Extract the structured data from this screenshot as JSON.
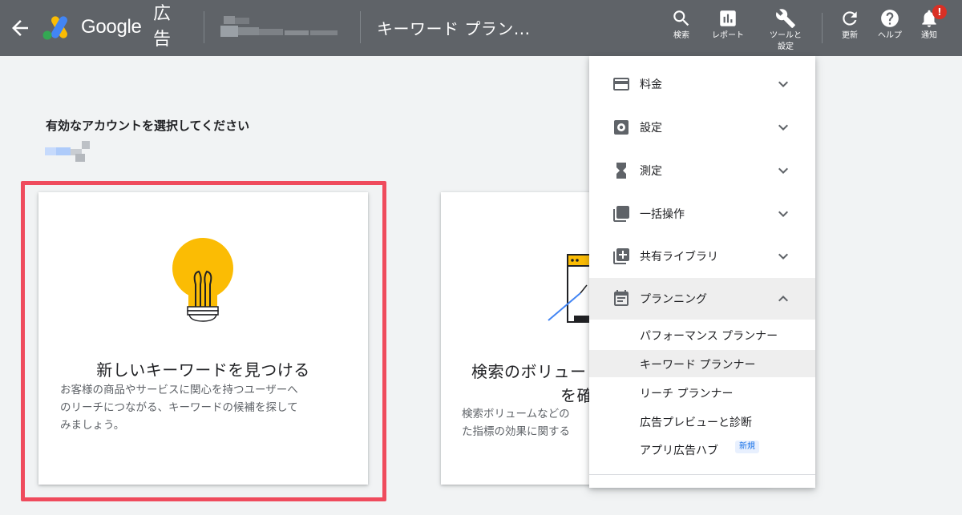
{
  "topbar": {
    "brand": "Google",
    "brand_sub": "広告",
    "breadcrumb": "キーワード プラン...",
    "actions": [
      {
        "label": "検索",
        "icon": "search-icon"
      },
      {
        "label": "レポート",
        "icon": "bar-chart-icon"
      },
      {
        "label": "ツールと設定",
        "icon": "wrench-icon"
      },
      {
        "label": "更新",
        "icon": "refresh-icon"
      },
      {
        "label": "ヘルプ",
        "icon": "help-icon"
      },
      {
        "label": "通知",
        "icon": "bell-icon"
      }
    ],
    "notification_badge": "!"
  },
  "main": {
    "heading": "有効なアカウントを選択してください",
    "cards": [
      {
        "title": "新しいキーワードを見つける",
        "description_lines": [
          "お客様の商品やサービスに関心を持つユーザーへ",
          "のリーチにつながる、キーワードの候補を探して",
          "みましょう。"
        ],
        "icon": "lightbulb-icon"
      },
      {
        "title_line1": "検索のボリュー",
        "title_line2": "を確",
        "description_lines": [
          "検索ボリュームなどの",
          "た指標の効果に関する"
        ],
        "icon": "chart-window-icon"
      }
    ]
  },
  "menu": {
    "sections": [
      {
        "label": "料金",
        "icon": "credit-card-icon",
        "expanded": false
      },
      {
        "label": "設定",
        "icon": "settings-icon",
        "expanded": false
      },
      {
        "label": "測定",
        "icon": "hourglass-icon",
        "expanded": false
      },
      {
        "label": "一括操作",
        "icon": "copy-icon",
        "expanded": false
      },
      {
        "label": "共有ライブラリ",
        "icon": "library-icon",
        "expanded": false
      },
      {
        "label": "プランニング",
        "icon": "calendar-icon",
        "expanded": true
      }
    ],
    "planning_items": [
      {
        "label": "パフォーマンス プランナー",
        "selected": false
      },
      {
        "label": "キーワード プランナー",
        "selected": true
      },
      {
        "label": "リーチ プランナー",
        "selected": false
      },
      {
        "label": "広告プレビューと診断",
        "selected": false
      },
      {
        "label": "アプリ広告ハブ",
        "selected": false,
        "badge": "新規"
      }
    ]
  },
  "colors": {
    "topbar": "#5f6368",
    "background": "#f1f3f4",
    "highlight": "#ef4b5d",
    "lightbulb": "#fbbc04",
    "accent_blue": "#1a73e8"
  }
}
